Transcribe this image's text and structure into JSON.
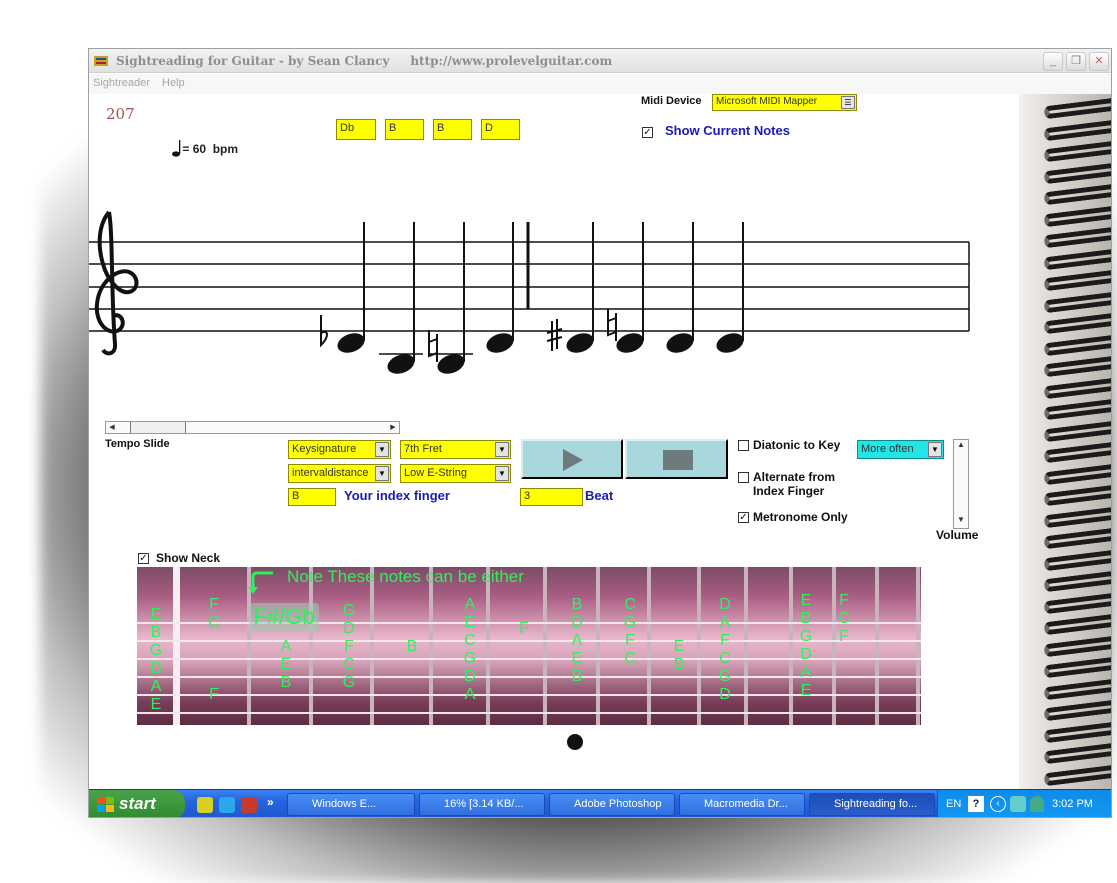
{
  "window": {
    "title": "Sightreading for Guitar - by Sean Clancy     http://www.prolevelguitar.com",
    "controls": [
      "_",
      "❐",
      "✕"
    ]
  },
  "menu": [
    "Sightreader",
    "Help"
  ],
  "header": {
    "counter": "207",
    "tempo_value": "60",
    "tempo_unit": "bpm",
    "note_boxes": [
      "Db",
      "B",
      "B",
      "D"
    ],
    "midi_label": "Midi Device",
    "midi_value": "Microsoft MIDI Mapper",
    "show_current_notes": "Show Current Notes"
  },
  "controls": {
    "tempo_slide_label": "Tempo Slide",
    "tempo_slider_level": 0.2,
    "select_keysignature": "Keysignature",
    "select_fret": "7th Fret",
    "select_interval": "intervaldistance",
    "select_string": "Low E-String",
    "index_finger_value": "B",
    "index_finger_label": "Your index finger",
    "beat_value": "3",
    "beat_label": "Beat",
    "diatonic_label": "Diatonic to Key",
    "alternate_label": "Alternate from Index Finger",
    "metronome_label": "Metronome Only",
    "frequency_value": "More often",
    "volume_label": "Volume",
    "show_neck_label": "Show Neck"
  },
  "neck": {
    "note_banner": "Note These notes can be either",
    "sharp_flat": "F#/Gb",
    "columns": [
      [
        "E",
        "B",
        "G",
        "D",
        "A",
        "E"
      ],
      [
        "F",
        "C",
        "",
        "",
        "",
        "F"
      ],
      [
        "A",
        "E",
        "B"
      ],
      [
        "G",
        "D",
        "F",
        "C",
        "G"
      ],
      [
        "B"
      ],
      [
        "A",
        "E",
        "C",
        "G",
        "D",
        "A"
      ],
      [
        "F"
      ],
      [
        "B",
        "D",
        "A",
        "E",
        "B"
      ],
      [
        "C",
        "G",
        "F",
        "C"
      ],
      [
        "E",
        "B"
      ],
      [
        "D",
        "A",
        "F",
        "C",
        "G",
        "D"
      ],
      [
        "E",
        "B",
        "G",
        "D",
        "A",
        "E"
      ],
      [
        "F",
        "C",
        "F"
      ]
    ]
  },
  "taskbar": {
    "start": "start",
    "tasks": [
      "Windows E...",
      "16% [3.14 KB/...",
      "Adobe Photoshop",
      "Macromedia Dr...",
      "Sightreading fo..."
    ],
    "lang": "EN",
    "time": "3:02 PM"
  }
}
